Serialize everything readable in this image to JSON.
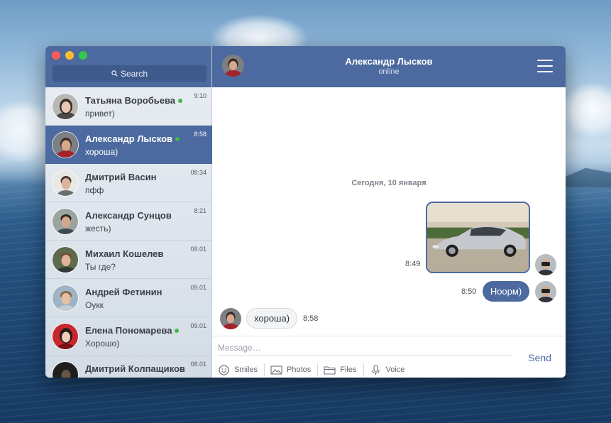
{
  "sidebar": {
    "search_label": "Search",
    "chats": [
      {
        "name": "Татьяна Воробьева",
        "preview": "привет)",
        "time": "9:10",
        "online": true,
        "active": false
      },
      {
        "name": "Александр Лысков",
        "preview": "хороша)",
        "time": "8:58",
        "online": true,
        "active": true
      },
      {
        "name": "Дмитрий Васин",
        "preview": "пфф",
        "time": "08:34",
        "online": false,
        "active": false
      },
      {
        "name": "Александр Сунцов",
        "preview": "жесть)",
        "time": "8:21",
        "online": false,
        "active": false
      },
      {
        "name": "Михаил Кошелев",
        "preview": "Ты где?",
        "time": "09.01",
        "online": false,
        "active": false
      },
      {
        "name": "Андрей Фетинин",
        "preview": "Оукк",
        "time": "09.01",
        "online": false,
        "active": false
      },
      {
        "name": "Елена Пономарева",
        "preview": "Хорошо)",
        "time": "09.01",
        "online": true,
        "active": false
      },
      {
        "name": "Дмитрий Колпащиков",
        "preview": "",
        "time": "08.01",
        "online": false,
        "active": false
      }
    ]
  },
  "header": {
    "contact_name": "Александр Лысков",
    "status": "online"
  },
  "conversation": {
    "date_separator": "Сегодня, 10 января",
    "photo_message": {
      "time": "8:49",
      "image": "car-photo"
    },
    "outgoing_message": {
      "text": "Ноорм)",
      "time": "8:50"
    },
    "incoming_message": {
      "text": "хороша)",
      "time": "8:58"
    }
  },
  "composer": {
    "placeholder": "Message…",
    "send_label": "Send",
    "tools": [
      {
        "label": "Smiles",
        "icon": "smile-icon"
      },
      {
        "label": "Photos",
        "icon": "photo-icon"
      },
      {
        "label": "Files",
        "icon": "folder-icon"
      },
      {
        "label": "Voice",
        "icon": "microphone-icon"
      }
    ]
  },
  "colors": {
    "accent": "#4c6a9f",
    "online": "#3dbb4a"
  }
}
